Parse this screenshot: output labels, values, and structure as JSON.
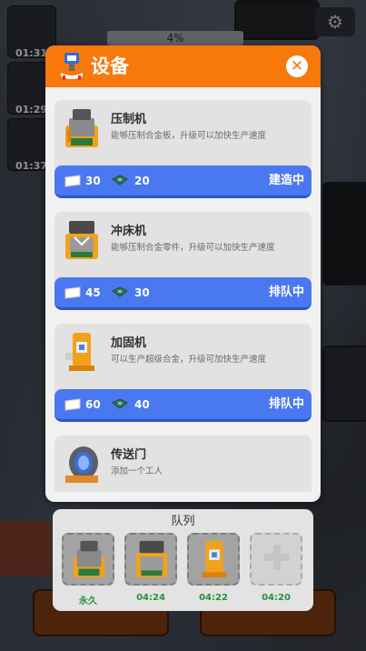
{
  "hud": {
    "timers": [
      "01:31",
      "01:29",
      "01:37"
    ],
    "progress": "4%",
    "settings_icon": "gear-icon"
  },
  "dialog": {
    "title": "设备",
    "header_icon": "machine-icon",
    "close_icon": "close-icon",
    "items": [
      {
        "name": "压制机",
        "desc": "能够压制合金板，升级可以加快生产速度",
        "icon": "press-machine-icon",
        "cost": [
          "30",
          "20"
        ],
        "cost_icons": [
          "paper-icon",
          "circuit-board-icon"
        ],
        "status": "建造中"
      },
      {
        "name": "冲床机",
        "desc": "能够压制合金零件，升级可以加快生产速度",
        "icon": "punch-machine-icon",
        "cost": [
          "45",
          "30"
        ],
        "cost_icons": [
          "paper-icon",
          "circuit-board-icon"
        ],
        "status": "排队中"
      },
      {
        "name": "加固机",
        "desc": "可以生产超级合金，升级可加快生产速度",
        "icon": "reinforce-machine-icon",
        "cost": [
          "60",
          "40"
        ],
        "cost_icons": [
          "paper-icon",
          "circuit-board-icon"
        ],
        "status": "排队中"
      },
      {
        "name": "传送门",
        "desc": "添加一个工人",
        "icon": "portal-icon"
      }
    ]
  },
  "queue": {
    "title": "队列",
    "slots": [
      {
        "icon": "press-machine-icon",
        "time": "永久"
      },
      {
        "icon": "punch-machine-icon",
        "time": "04:24"
      },
      {
        "icon": "reinforce-machine-icon",
        "time": "04:22"
      },
      {
        "icon": "add-slot-icon",
        "time": "04:20"
      }
    ]
  },
  "colors": {
    "header": "#f7780b",
    "action": "#4a78f0",
    "time_text": "#26913c"
  }
}
